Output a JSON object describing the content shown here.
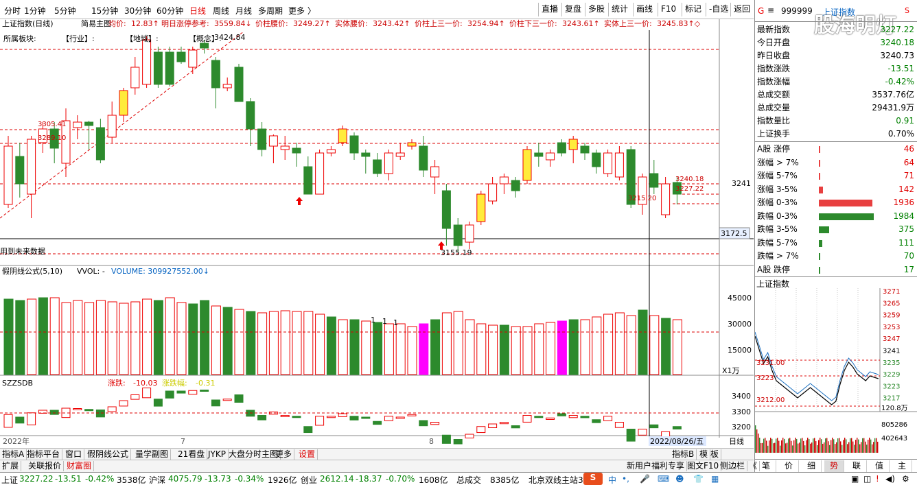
{
  "period_tabs": [
    "分时",
    "1分钟",
    "5分钟",
    "15分钟",
    "30分钟",
    "60分钟",
    "日线",
    "周线",
    "月线",
    "多周期",
    "更多 〉"
  ],
  "active_period": "日线",
  "toolbar_buttons": [
    "直播",
    "复盘",
    "多股",
    "统计",
    "画线",
    "F10",
    "标记",
    "-自选",
    "返回"
  ],
  "main_header": {
    "title": "上证指数(日线)",
    "indicator": "简易主图",
    "items": [
      {
        "label": "均价:",
        "value": "12.83↑"
      },
      {
        "label": "明日涨停参考:",
        "value": "3559.84↓"
      },
      {
        "label": "价柱腰价:",
        "value": "3249.27↑"
      },
      {
        "label": "实体腰价:",
        "value": "3243.42↑"
      },
      {
        "label": "价柱上三一价:",
        "value": "3254.94↑"
      },
      {
        "label": "价柱下三一价:",
        "value": "3243.61↑"
      },
      {
        "label": "实体上三一价:",
        "value": "3245.83↑◇"
      }
    ],
    "sector_label": "所属板块:",
    "sector_industry": "【行业】:",
    "sector_region": "【地域】:",
    "sector_concept": "【概念】:",
    "future_data_note": "用到未来数据"
  },
  "price_labels": {
    "high": "3424.84",
    "low": "3155.19",
    "l1": "3305.41",
    "l2": "3289.10",
    "l3": "3240.18",
    "l4": "3227.22",
    "l5": "3215.20",
    "axis_3241": "3241",
    "crosshair_price": "3172.5"
  },
  "volume_panel": {
    "title": "假阴线公式(5,10)",
    "vvol": "VVOL: -",
    "volume_label": "VOLUME: 309927552.00↓",
    "axis": [
      "45000",
      "30000",
      "15000"
    ],
    "unit": "X1万",
    "marks": [
      "1",
      "1",
      "1"
    ]
  },
  "szzsdb_panel": {
    "title": "SZZSDB",
    "zhangdie_label": "涨跌:",
    "zhangdie_value": "-10.03",
    "zhangfu_label": "涨跌幅:",
    "zhangfu_value": "-0.31",
    "axis": [
      "3400",
      "3300",
      "3200"
    ]
  },
  "x_axis": {
    "year": "2022年",
    "m7": "7",
    "m8": "8",
    "date": "2022/08/26/五",
    "period": "日线"
  },
  "bottom_tabs_1": [
    "指标A",
    "指标平台",
    "窗口",
    "假阴线公式",
    "量学副图",
    "21看盘",
    "JYKP",
    "大盘分时主图",
    "更多",
    "设置"
  ],
  "bottom_tabs_1_right": [
    "指标B",
    "模",
    "板"
  ],
  "bottom_tabs_2": [
    "扩展",
    "关联报价",
    "财富圈"
  ],
  "bottom_tabs_2_right": [
    "新用户福利专享",
    "图文F10",
    "侧边栏",
    "《"
  ],
  "status_bar": {
    "sh_label": "上证",
    "sh_price": "3227.22",
    "sh_change": "-13.51",
    "sh_pct": "-0.42%",
    "sh_amt": "3538亿",
    "hs_label": "沪深",
    "hs_price": "4075.79",
    "hs_change": "-13.73",
    "hs_pct": "-0.34%",
    "hs_amt": "1926亿",
    "cy_label": "创业",
    "cy_price": "2612.14",
    "cy_change": "-18.37",
    "cy_pct": "-0.70%",
    "cy_amt": "1608亿",
    "total_label": "总成交",
    "total_amt": "8385亿",
    "news": "北京双线主站3",
    "ime": "中"
  },
  "right_panel": {
    "code": "999999",
    "name": "上证指数",
    "badge": "S",
    "g_mark": "G",
    "watermark": "股海明灯",
    "stats": [
      {
        "label": "最新指数",
        "value": "3227.22",
        "color": "green"
      },
      {
        "label": "今日开盘",
        "value": "3240.18",
        "color": "green"
      },
      {
        "label": "昨日收盘",
        "value": "3240.73",
        "color": "black"
      },
      {
        "label": "指数涨跌",
        "value": "-13.51",
        "color": "green"
      },
      {
        "label": "指数涨幅",
        "value": "-0.42%",
        "color": "green"
      },
      {
        "label": "总成交额",
        "value": "3537.76亿",
        "color": "black"
      },
      {
        "label": "总成交量",
        "value": "29431.9万",
        "color": "black"
      },
      {
        "label": "指数量比",
        "value": "0.91",
        "color": "green"
      },
      {
        "label": "上证换手",
        "value": "0.70%",
        "color": "black"
      }
    ],
    "breadth": [
      {
        "label": "A股 涨停",
        "value": "46",
        "color": "red",
        "bar": 2
      },
      {
        "label": "涨幅 > 7%",
        "value": "64",
        "color": "red",
        "bar": 3
      },
      {
        "label": "涨幅 5-7%",
        "value": "71",
        "color": "red",
        "bar": 3
      },
      {
        "label": "涨幅 3-5%",
        "value": "142",
        "color": "red",
        "bar": 7
      },
      {
        "label": "涨幅 0-3%",
        "value": "1936",
        "color": "red",
        "bar": 98
      },
      {
        "label": "跌幅 0-3%",
        "value": "1984",
        "color": "green",
        "bar": 100
      },
      {
        "label": "跌幅 3-5%",
        "value": "375",
        "color": "green",
        "bar": 19
      },
      {
        "label": "跌幅 5-7%",
        "value": "111",
        "color": "green",
        "bar": 6
      },
      {
        "label": "跌幅 > 7%",
        "value": "70",
        "color": "green",
        "bar": 3
      },
      {
        "label": "A股 跌停",
        "value": "17",
        "color": "green",
        "bar": 1
      }
    ],
    "mini_title": "上证指数",
    "mini_axis": [
      "3271",
      "3265",
      "3259",
      "3253",
      "3247",
      "3241",
      "3235",
      "3229",
      "3223",
      "3217"
    ],
    "mini_labels": {
      "a": "3231.00",
      "b": "3223",
      "c": "3212.00"
    },
    "mini_vol_axis": [
      "120.8万",
      "805286",
      "402643"
    ],
    "tabs": [
      "笔",
      "价",
      "细",
      "势",
      "联",
      "值",
      "主"
    ],
    "active_tab": "势"
  }
}
